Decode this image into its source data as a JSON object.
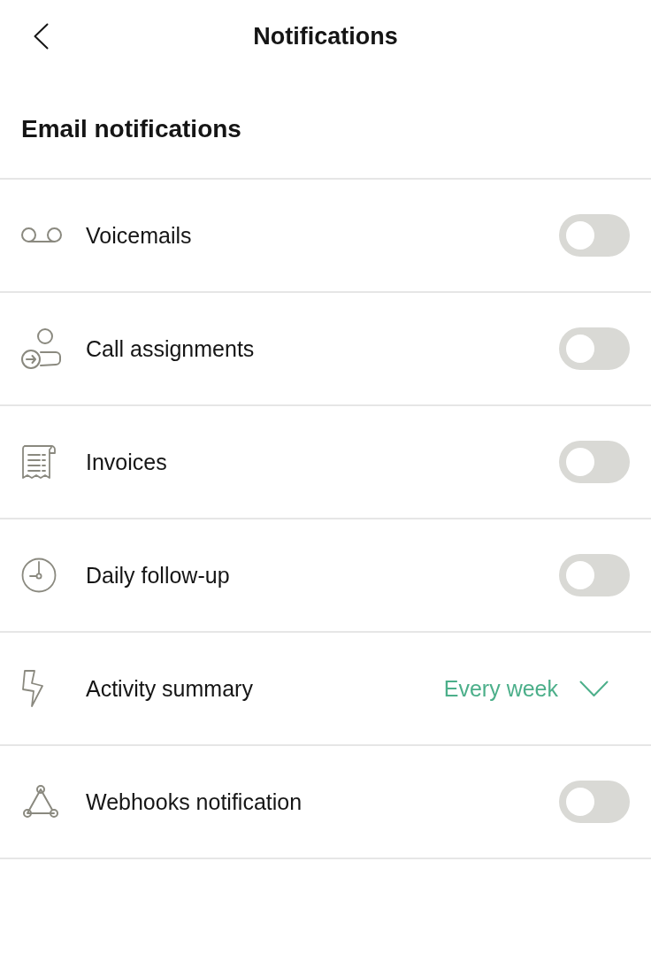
{
  "header": {
    "title": "Notifications"
  },
  "section": {
    "title": "Email notifications"
  },
  "items": [
    {
      "kind": "toggle",
      "label": "Voicemails",
      "on": false
    },
    {
      "kind": "toggle",
      "label": "Call assignments",
      "on": false
    },
    {
      "kind": "toggle",
      "label": "Invoices",
      "on": false
    },
    {
      "kind": "toggle",
      "label": "Daily follow-up",
      "on": false
    },
    {
      "kind": "select",
      "label": "Activity summary",
      "value": "Every week"
    },
    {
      "kind": "toggle",
      "label": "Webhooks notification",
      "on": false
    }
  ]
}
